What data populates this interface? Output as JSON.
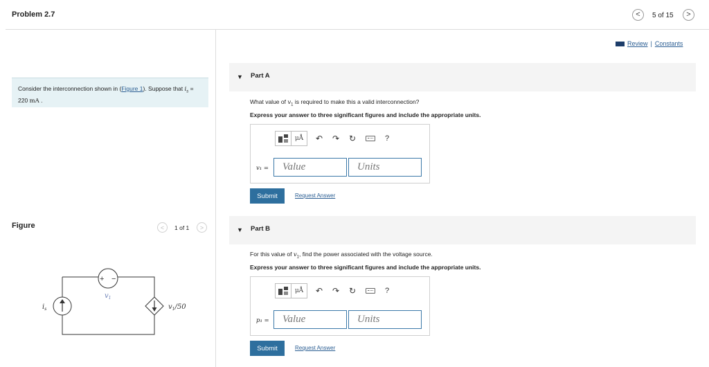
{
  "header": {
    "title": "Problem 2.7",
    "page_count": "5 of 15",
    "review_label": "Review",
    "separator": "|",
    "constants_label": "Constants"
  },
  "intro": {
    "text_before_link": "Consider the interconnection shown in (",
    "link_label": "Figure 1",
    "text_after_link": "). Suppose that ",
    "source_symbol": "i",
    "source_subscript": "s",
    "equals": " = 220 ",
    "unit": "mA",
    "end": " ."
  },
  "figure": {
    "label": "Figure",
    "count": "1 of 1",
    "left_source_label": "i",
    "left_source_subscript": "s",
    "plus": "+",
    "minus": "−",
    "voltage_label": "v",
    "voltage_subscript": "1",
    "dependent_label": "v",
    "dependent_subscript": "1",
    "dependent_suffix": "/50"
  },
  "part_a": {
    "title": "Part A",
    "question_before": "What value of ",
    "question_var": "v",
    "question_sub": "1",
    "question_after": " is required to make this a valid interconnection?",
    "instruction": "Express your answer to three significant figures and include the appropriate units.",
    "variable_label": "v₁ =",
    "value_placeholder": "Value",
    "units_placeholder": "Units",
    "submit_label": "Submit",
    "request_label": "Request Answer"
  },
  "part_b": {
    "title": "Part B",
    "question_before": "For this value of ",
    "question_var": "v",
    "question_sub": "1",
    "question_after": ", find the power associated with the voltage source.",
    "instruction": "Express your answer to three significant figures and include the appropriate units.",
    "variable_label": "p₁ =",
    "value_placeholder": "Value",
    "units_placeholder": "Units",
    "submit_label": "Submit",
    "request_label": "Request Answer"
  },
  "toolbar": {
    "units_button_label": "μÅ",
    "help_label": "?",
    "icons": [
      "templates-icon",
      "units-icon",
      "undo-icon",
      "redo-icon",
      "reset-icon",
      "keyboard-icon",
      "help-icon"
    ]
  },
  "nav": {
    "prev_symbol": "<",
    "next_symbol": ">"
  },
  "colors": {
    "accent": "#2e6f9e",
    "link": "#2a5d92",
    "intro_bg": "#e6f2f5",
    "part_header_bg": "#f4f4f4",
    "field_border": "#3b78a8",
    "circuit_label": "#6a7fb5"
  }
}
